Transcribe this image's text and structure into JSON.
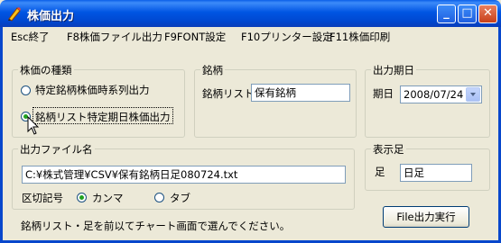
{
  "window": {
    "title": "株価出力"
  },
  "titlebar_buttons": {
    "minimize": "_",
    "maximize": "□",
    "close": "✕"
  },
  "menu": [
    "Esc終了",
    "F8株価ファイル出力",
    "F9FONT設定",
    "F10プリンター設定",
    "F11株価印刷"
  ],
  "stock_type": {
    "title": "株価の種類",
    "options": [
      {
        "label": "特定銘柄株価時系列出力",
        "checked": false
      },
      {
        "label": "銘柄リスト特定期日株価出力",
        "checked": true
      }
    ]
  },
  "brand": {
    "title": "銘柄",
    "list_label": "銘柄リスト",
    "list_value": "保有銘柄"
  },
  "output_date": {
    "title": "出力期日",
    "date_label": "期日",
    "date_value": "2008/07/24"
  },
  "output_file": {
    "title": "出力ファイル名",
    "path": "C:¥株式管理¥CSV¥保有銘柄日足080724.txt",
    "delimiter_label": "区切記号",
    "delimiters": [
      {
        "label": "カンマ",
        "checked": true
      },
      {
        "label": "タブ",
        "checked": false
      }
    ]
  },
  "display_bar": {
    "title": "表示足",
    "label": "足",
    "value": "日足"
  },
  "hint": "銘柄リスト・足を前以てチャート画面で選んでください。",
  "execute_button": "File出力実行",
  "colors": {
    "titlebar": "#0055e3",
    "window_bg": "#ece9d8",
    "radio_dot": "#21a121"
  }
}
